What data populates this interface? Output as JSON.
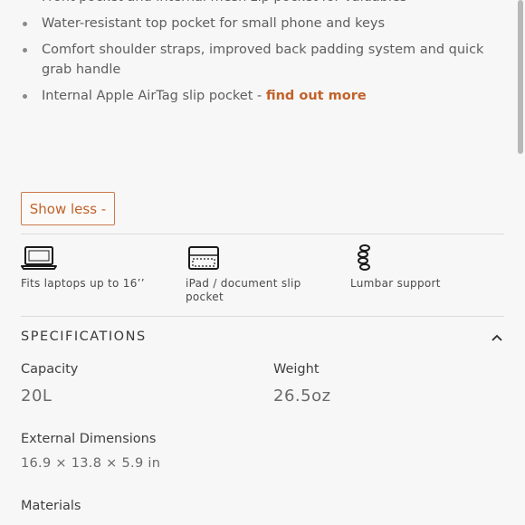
{
  "features_list": {
    "items": [
      "Front pocket and internal mesh zip pocket for valuables",
      "Water-resistant top pocket for small phone and keys",
      "Comfort shoulder straps, improved back padding system and quick grab handle"
    ],
    "airtag_text": "Internal Apple AirTag slip pocket - ",
    "airtag_link": "find out more"
  },
  "toggle": {
    "label": "Show less -"
  },
  "highlights": [
    {
      "icon": "laptop-icon",
      "label": "Fits laptops up to 16’’"
    },
    {
      "icon": "ipad-sleeve-icon",
      "label": "iPad / document slip pocket"
    },
    {
      "icon": "lumbar-support-icon",
      "label": "Lumbar support"
    }
  ],
  "specifications": {
    "title": "SPECIFICATIONS",
    "capacity_label": "Capacity",
    "capacity_value": "20L",
    "weight_label": "Weight",
    "weight_value": "26.5oz",
    "dimensions_label": "External Dimensions",
    "dimensions_value": "16.9 × 13.8 × 5.9 in",
    "materials_label": "Materials"
  },
  "colors": {
    "accent": "#c2622a",
    "background": "#f7f7f7"
  }
}
